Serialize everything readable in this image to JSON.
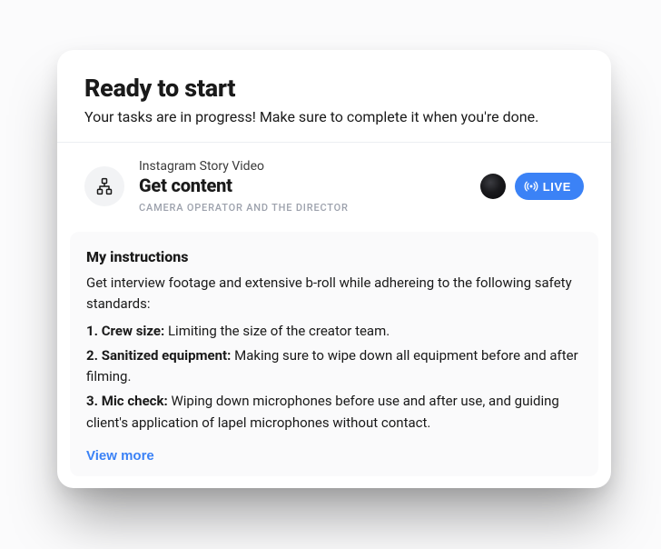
{
  "header": {
    "title": "Ready to start",
    "subtitle": "Your tasks are in progress! Make sure to complete it when you're done."
  },
  "task": {
    "kicker": "Instagram Story Video",
    "title": "Get content",
    "roles": "CAMERA OPERATOR AND THE DIRECTOR",
    "live_label": "LIVE"
  },
  "instructions": {
    "heading": "My instructions",
    "intro": "Get interview footage and extensive b-roll while adhereing to the following safety standards:",
    "items": [
      {
        "num": "1.",
        "label": "Crew size:",
        "text": "Limiting the size of the creator team."
      },
      {
        "num": "2.",
        "label": "Sanitized equipment:",
        "text": "Making sure to wipe down all equipment before and after filming."
      },
      {
        "num": "3.",
        "label": "Mic check:",
        "text": "Wiping down microphones before use and after use, and guiding client's application of lapel microphones without contact."
      }
    ],
    "view_more": "View more"
  }
}
